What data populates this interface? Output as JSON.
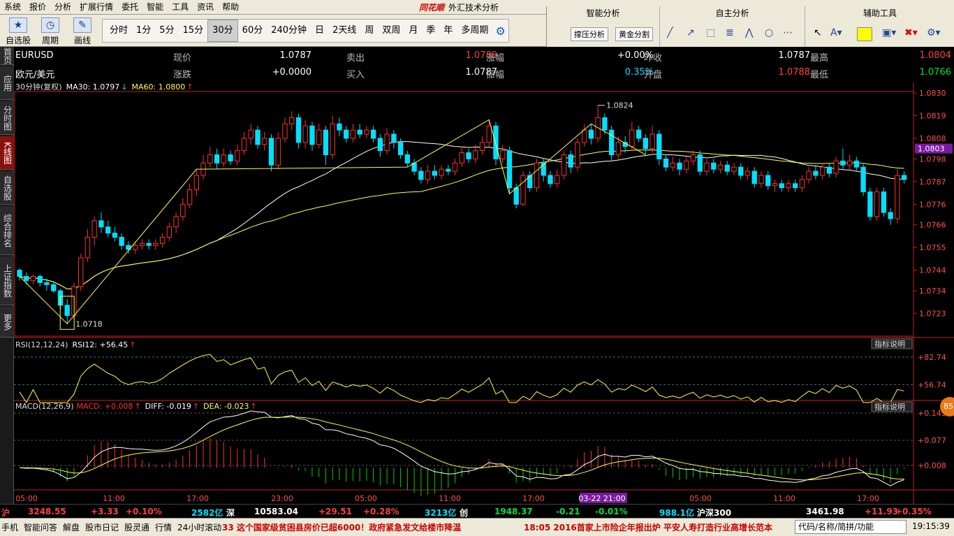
{
  "menu": [
    "系统",
    "报价",
    "分析",
    "扩展行情",
    "委托",
    "智能",
    "工具",
    "资讯",
    "帮助"
  ],
  "app": {
    "brand": "同花顺",
    "title": "外汇技术分析"
  },
  "toolbar": {
    "buttons": [
      {
        "label": "自选股",
        "icon": "star-icon"
      },
      {
        "label": "周期",
        "icon": "clock-icon"
      },
      {
        "label": "画线",
        "icon": "pen-icon"
      }
    ],
    "periods": [
      "分时",
      "1分",
      "5分",
      "15分",
      "30分",
      "60分",
      "240分钟",
      "日",
      "2天线",
      "周",
      "双周",
      "月",
      "季",
      "年",
      "多周期"
    ],
    "active_period": "30分"
  },
  "right_panel": {
    "smart": {
      "title": "智能分析",
      "buttons": [
        "撑压分析",
        "黄金分割"
      ]
    },
    "self": {
      "title": "自主分析"
    },
    "aux": {
      "title": "辅助工具"
    }
  },
  "left_tabs": [
    "首页",
    "应用",
    "分时图",
    "K线图",
    "自选股",
    "综合排名",
    "上证指数",
    "更多"
  ],
  "active_left_tab": "K线图",
  "quote": {
    "code": "EURUSD",
    "name": "欧元/美元",
    "rows": [
      [
        {
          "l": "现价",
          "v": "1.0787"
        },
        {
          "l": "卖出",
          "v": "1.0789"
        },
        {
          "l": "涨幅",
          "v": "+0.00%"
        },
        {
          "l": "昨收",
          "v": "1.0787"
        },
        {
          "l": "最高",
          "v": "1.0804"
        }
      ],
      [
        {
          "l": "涨跌",
          "v": "+0.0000"
        },
        {
          "l": "买入",
          "v": "1.0787"
        },
        {
          "l": "振幅",
          "v": "0.35%"
        },
        {
          "l": "开盘",
          "v": "1.0788"
        },
        {
          "l": "最低",
          "v": "1.0766"
        }
      ]
    ]
  },
  "colors": {
    "up": "#ff3030",
    "down": "#00e0ff",
    "ma30": "#ffffff",
    "ma60": "#ffff40",
    "zigzag": "#ffff40",
    "axis": "#c81e1e",
    "grid": "#5a0000",
    "rsi": "#ffff40",
    "macd_up": "#ff3030",
    "macd_down": "#00d000"
  },
  "chart_data": {
    "type": "candlestick",
    "main_label": "30分钟(复权)",
    "ma30_label": "MA30: 1.0797",
    "ma60_label": "MA60: 1.0800",
    "ylim": [
      1.0712,
      1.083
    ],
    "yticks": [
      "1.0830",
      "1.0819",
      "1.0808",
      "1.0798",
      "1.0787",
      "1.0776",
      "1.0766",
      "1.0755",
      "1.0744",
      "1.0734",
      "1.0723"
    ],
    "current_price": "1.0803",
    "high_mark": "1.0824",
    "low_mark": "1.0718",
    "xticks": [
      "05:00",
      "11:00",
      "17:00",
      "23:00",
      "05:00",
      "11:00",
      "17:00",
      "03-22 21:00",
      "05:00",
      "11:00",
      "17:00"
    ],
    "rsi": {
      "label": "RSI(12,12,24)",
      "value_label": "RSI12: +56.45",
      "yticks": [
        "+82.74",
        "+56.74"
      ],
      "ylim": [
        40,
        90
      ]
    },
    "macd": {
      "label": "MACD(12,26,9)",
      "macd": "MACD: +0.008",
      "diff": "DIFF: -0.019",
      "dea": "DEA: -0.023",
      "yticks": [
        "+0.143",
        "+0.077",
        "+0.008"
      ],
      "ylim": [
        -0.04,
        0.15
      ]
    },
    "indicator_btn": "指标说明",
    "candles": [
      [
        1.0744,
        1.0741,
        1.0745,
        1.0739
      ],
      [
        1.0741,
        1.0739,
        1.0743,
        1.0737
      ],
      [
        1.0739,
        1.0741,
        1.0742,
        1.0737
      ],
      [
        1.0741,
        1.0738,
        1.0742,
        1.0736
      ],
      [
        1.0738,
        1.0737,
        1.074,
        1.0734
      ],
      [
        1.0737,
        1.0734,
        1.0738,
        1.0733
      ],
      [
        1.0734,
        1.0727,
        1.0735,
        1.0725
      ],
      [
        1.0727,
        1.0722,
        1.073,
        1.0718
      ],
      [
        1.0722,
        1.0736,
        1.0738,
        1.072
      ],
      [
        1.0736,
        1.075,
        1.0752,
        1.0734
      ],
      [
        1.075,
        1.076,
        1.0764,
        1.0748
      ],
      [
        1.076,
        1.0768,
        1.077,
        1.0756
      ],
      [
        1.0768,
        1.0765,
        1.0772,
        1.0762
      ],
      [
        1.0765,
        1.0762,
        1.0768,
        1.076
      ],
      [
        1.0762,
        1.076,
        1.0765,
        1.0758
      ],
      [
        1.076,
        1.0756,
        1.0762,
        1.0754
      ],
      [
        1.0756,
        1.0754,
        1.0758,
        1.0752
      ],
      [
        1.0754,
        1.0756,
        1.0758,
        1.0752
      ],
      [
        1.0756,
        1.0757,
        1.0759,
        1.0754
      ],
      [
        1.0757,
        1.0756,
        1.0759,
        1.0754
      ],
      [
        1.0756,
        1.0757,
        1.0759,
        1.0754
      ],
      [
        1.0757,
        1.076,
        1.0762,
        1.0755
      ],
      [
        1.076,
        1.0765,
        1.0767,
        1.0758
      ],
      [
        1.0765,
        1.077,
        1.0772,
        1.0762
      ],
      [
        1.077,
        1.0776,
        1.0779,
        1.0768
      ],
      [
        1.0776,
        1.0783,
        1.0786,
        1.0774
      ],
      [
        1.0783,
        1.079,
        1.0793,
        1.078
      ],
      [
        1.079,
        1.0796,
        1.08,
        1.0788
      ],
      [
        1.0796,
        1.08,
        1.0804,
        1.0794
      ],
      [
        1.08,
        1.0796,
        1.0803,
        1.0793
      ],
      [
        1.0796,
        1.08,
        1.0803,
        1.0794
      ],
      [
        1.08,
        1.0797,
        1.0802,
        1.0795
      ],
      [
        1.0797,
        1.0802,
        1.0805,
        1.0795
      ],
      [
        1.0802,
        1.0808,
        1.0811,
        1.08
      ],
      [
        1.0808,
        1.0812,
        1.0815,
        1.0805
      ],
      [
        1.0812,
        1.0805,
        1.0814,
        1.0803
      ],
      [
        1.0805,
        1.0808,
        1.0811,
        1.0802
      ],
      [
        1.0808,
        1.0795,
        1.081,
        1.0792
      ],
      [
        1.0795,
        1.0808,
        1.0811,
        1.0793
      ],
      [
        1.0808,
        1.0815,
        1.0818,
        1.0806
      ],
      [
        1.0815,
        1.0818,
        1.0821,
        1.0812
      ],
      [
        1.0818,
        1.0806,
        1.082,
        1.0803
      ],
      [
        1.0806,
        1.0814,
        1.0817,
        1.0803
      ],
      [
        1.0814,
        1.0805,
        1.0816,
        1.0802
      ],
      [
        1.0805,
        1.0812,
        1.0815,
        1.0803
      ],
      [
        1.0812,
        1.08,
        1.0814,
        1.0795
      ],
      [
        1.08,
        1.0815,
        1.0819,
        1.0798
      ],
      [
        1.0815,
        1.0812,
        1.0818,
        1.0809
      ],
      [
        1.0812,
        1.0808,
        1.0814,
        1.0806
      ],
      [
        1.0808,
        1.0812,
        1.0815,
        1.0806
      ],
      [
        1.0812,
        1.081,
        1.0815,
        1.0808
      ],
      [
        1.081,
        1.0812,
        1.0814,
        1.0808
      ],
      [
        1.0812,
        1.0808,
        1.0814,
        1.0806
      ],
      [
        1.0808,
        1.0802,
        1.081,
        1.0799
      ],
      [
        1.0802,
        1.081,
        1.0813,
        1.08
      ],
      [
        1.081,
        1.0806,
        1.0812,
        1.0803
      ],
      [
        1.0806,
        1.08,
        1.0808,
        1.0798
      ],
      [
        1.08,
        1.0796,
        1.0802,
        1.0794
      ],
      [
        1.0796,
        1.0792,
        1.0798,
        1.079
      ],
      [
        1.0792,
        1.0788,
        1.0794,
        1.0786
      ],
      [
        1.0788,
        1.0792,
        1.0795,
        1.0786
      ],
      [
        1.0792,
        1.079,
        1.0795,
        1.0788
      ],
      [
        1.079,
        1.0793,
        1.0795,
        1.0788
      ],
      [
        1.0793,
        1.0792,
        1.0795,
        1.079
      ],
      [
        1.0792,
        1.0796,
        1.0798,
        1.079
      ],
      [
        1.0796,
        1.0801,
        1.0804,
        1.0794
      ],
      [
        1.0801,
        1.0798,
        1.0803,
        1.0796
      ],
      [
        1.0798,
        1.0802,
        1.0805,
        1.0796
      ],
      [
        1.0802,
        1.0806,
        1.0809,
        1.08
      ],
      [
        1.0806,
        1.0814,
        1.0817,
        1.0804
      ],
      [
        1.0814,
        1.0798,
        1.0816,
        1.0795
      ],
      [
        1.0798,
        1.0802,
        1.0805,
        1.0796
      ],
      [
        1.0802,
        1.0784,
        1.0804,
        1.0781
      ],
      [
        1.0784,
        1.0776,
        1.0786,
        1.0774
      ],
      [
        1.0776,
        1.079,
        1.0792,
        1.0775
      ],
      [
        1.079,
        1.0784,
        1.0792,
        1.0782
      ],
      [
        1.0784,
        1.0796,
        1.0798,
        1.0782
      ],
      [
        1.0796,
        1.079,
        1.0798,
        1.0787
      ],
      [
        1.079,
        1.0786,
        1.0792,
        1.0784
      ],
      [
        1.0786,
        1.079,
        1.0793,
        1.0784
      ],
      [
        1.079,
        1.08,
        1.0802,
        1.0788
      ],
      [
        1.08,
        1.0794,
        1.0802,
        1.0791
      ],
      [
        1.0794,
        1.0806,
        1.0808,
        1.0792
      ],
      [
        1.0806,
        1.0812,
        1.0815,
        1.0804
      ],
      [
        1.0812,
        1.0808,
        1.0815,
        1.0805
      ],
      [
        1.0808,
        1.0818,
        1.0824,
        1.0806
      ],
      [
        1.0818,
        1.0812,
        1.082,
        1.081
      ],
      [
        1.0812,
        1.08,
        1.0814,
        1.0797
      ],
      [
        1.08,
        1.0806,
        1.0809,
        1.0798
      ],
      [
        1.0806,
        1.0804,
        1.0809,
        1.0801
      ],
      [
        1.0804,
        1.0812,
        1.0816,
        1.0802
      ],
      [
        1.0812,
        1.0808,
        1.0814,
        1.0806
      ],
      [
        1.0808,
        1.0803,
        1.081,
        1.08
      ],
      [
        1.0803,
        1.081,
        1.0814,
        1.0801
      ],
      [
        1.081,
        1.0798,
        1.0812,
        1.0795
      ],
      [
        1.0798,
        1.0794,
        1.08,
        1.0792
      ],
      [
        1.0794,
        1.0796,
        1.0799,
        1.0792
      ],
      [
        1.0796,
        1.0793,
        1.0798,
        1.079
      ],
      [
        1.0793,
        1.0797,
        1.0799,
        1.0791
      ],
      [
        1.0797,
        1.08,
        1.0802,
        1.0795
      ],
      [
        1.08,
        1.0792,
        1.0802,
        1.079
      ],
      [
        1.0792,
        1.0796,
        1.0798,
        1.079
      ],
      [
        1.0796,
        1.0793,
        1.0798,
        1.0791
      ],
      [
        1.0793,
        1.0795,
        1.0797,
        1.0791
      ],
      [
        1.0795,
        1.0792,
        1.0797,
        1.079
      ],
      [
        1.0792,
        1.0794,
        1.0796,
        1.079
      ],
      [
        1.0794,
        1.079,
        1.0796,
        1.0788
      ],
      [
        1.079,
        1.0792,
        1.0794,
        1.0788
      ],
      [
        1.0792,
        1.0786,
        1.0794,
        1.0784
      ],
      [
        1.0786,
        1.079,
        1.0792,
        1.0784
      ],
      [
        1.079,
        1.0785,
        1.0792,
        1.0783
      ],
      [
        1.0785,
        1.0786,
        1.0788,
        1.0782
      ],
      [
        1.0786,
        1.0784,
        1.0788,
        1.0782
      ],
      [
        1.0784,
        1.0786,
        1.0788,
        1.0782
      ],
      [
        1.0786,
        1.0784,
        1.0788,
        1.0782
      ],
      [
        1.0784,
        1.0788,
        1.079,
        1.0782
      ],
      [
        1.0788,
        1.0792,
        1.0794,
        1.0786
      ],
      [
        1.0792,
        1.079,
        1.0795,
        1.0788
      ],
      [
        1.079,
        1.0794,
        1.0796,
        1.0788
      ],
      [
        1.0794,
        1.0791,
        1.0796,
        1.0789
      ],
      [
        1.0791,
        1.0797,
        1.0799,
        1.0789
      ],
      [
        1.0797,
        1.0795,
        1.0803,
        1.0793
      ],
      [
        1.0795,
        1.0797,
        1.08,
        1.0793
      ],
      [
        1.0797,
        1.0794,
        1.0799,
        1.0792
      ],
      [
        1.0794,
        1.0782,
        1.0796,
        1.078
      ],
      [
        1.0782,
        1.077,
        1.0784,
        1.0768
      ],
      [
        1.077,
        1.0782,
        1.0784,
        1.0768
      ],
      [
        1.0782,
        1.0772,
        1.0784,
        1.077
      ],
      [
        1.0772,
        1.0769,
        1.0774,
        1.0766
      ],
      [
        1.0769,
        1.079,
        1.0793,
        1.0767
      ],
      [
        1.079,
        1.0788,
        1.0792,
        1.0786
      ]
    ]
  },
  "status": {
    "items": [
      {
        "t": "沪",
        "c": "red"
      },
      {
        "t": "3248.55",
        "c": "red"
      },
      {
        "t": "+3.33",
        "c": "red"
      },
      {
        "t": "+0.10%",
        "c": "red"
      },
      {
        "t": "2582亿",
        "c": "cyan"
      },
      {
        "t": "深",
        "c": "white"
      },
      {
        "t": "10583.04",
        "c": "white"
      },
      {
        "t": "+29.51",
        "c": "red"
      },
      {
        "t": "+0.28%",
        "c": "red"
      },
      {
        "t": "3213亿",
        "c": "cyan"
      },
      {
        "t": "创",
        "c": "white"
      },
      {
        "t": "1948.37",
        "c": "green"
      },
      {
        "t": "-0.21",
        "c": "green"
      },
      {
        "t": "-0.01%",
        "c": "green"
      },
      {
        "t": "988.1亿",
        "c": "cyan"
      },
      {
        "t": "沪深300",
        "c": "white"
      },
      {
        "t": "3461.98",
        "c": "white"
      },
      {
        "t": "+11.93",
        "c": "red"
      },
      {
        "t": "+0.35%",
        "c": "red"
      }
    ]
  },
  "bottom": {
    "items": [
      "手机",
      "智能问答",
      "解盘",
      "股市日记",
      "股灵通",
      "行情",
      "24小时滚动"
    ],
    "ticker": "33 这个国家级贫困县房价已超6000！政府紧急发文给楼市降温",
    "ticker2": "18:05 2016首家上市险企年报出炉 平安人寿打造行业高增长范本",
    "search_placeholder": "代码/名称/简拼/功能",
    "clock": "19:15:39",
    "badge": "85"
  }
}
